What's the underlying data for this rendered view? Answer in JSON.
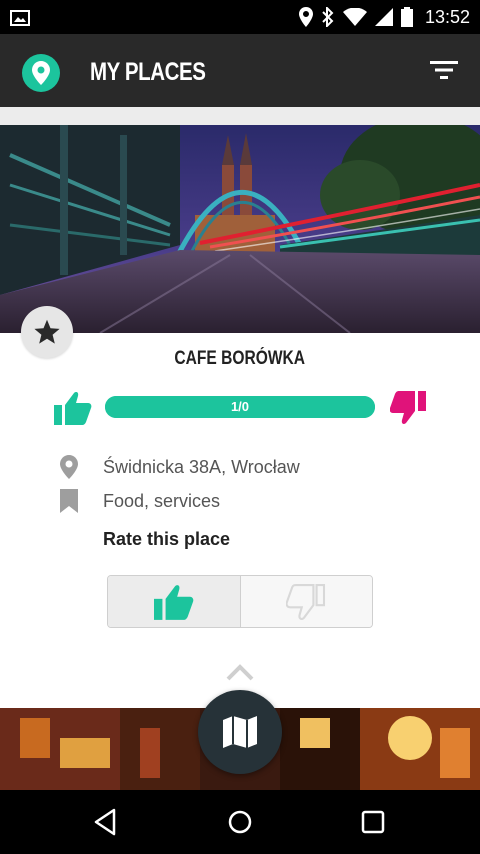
{
  "status_bar": {
    "time": "13:52",
    "icons": [
      "gallery-icon",
      "location-icon",
      "bluetooth-icon",
      "wifi-icon",
      "signal-icon",
      "battery-icon"
    ]
  },
  "app_bar": {
    "title": "MY PLACES",
    "logo_icon": "map-pin-icon",
    "filter_icon": "filter-icon"
  },
  "place": {
    "name": "CAFE BORÓWKA",
    "rating_text": "1/0",
    "rating_fraction": 1.0,
    "address": "Świdnicka 38A, Wrocław",
    "category": "Food, services",
    "rate_label": "Rate this place"
  },
  "colors": {
    "accent": "#1cc49d",
    "negative": "#e0137a",
    "app_bar": "#292929",
    "fab": "#263238"
  },
  "nav": {
    "icons": [
      "back-icon",
      "home-icon",
      "recents-icon"
    ]
  }
}
